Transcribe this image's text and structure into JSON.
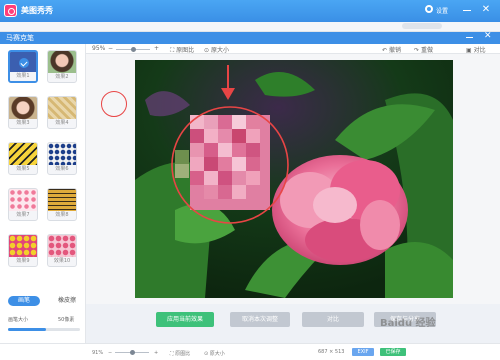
{
  "app": {
    "title": "美图秀秀",
    "settings_label": "设置"
  },
  "dialog": {
    "title": "马赛克笔"
  },
  "toolbar": {
    "zoom": "95%",
    "original_ratio": "原图比",
    "actual_size": "原大小",
    "undo": "撤销",
    "redo": "重做",
    "compare": "对比"
  },
  "effects": [
    {
      "label": "效果1",
      "selected": true
    },
    {
      "label": "效果2",
      "selected": false
    },
    {
      "label": "效果3",
      "selected": false
    },
    {
      "label": "效果4",
      "selected": false
    },
    {
      "label": "效果5",
      "selected": false
    },
    {
      "label": "效果6",
      "selected": false
    },
    {
      "label": "效果7",
      "selected": false
    },
    {
      "label": "效果8",
      "selected": false
    },
    {
      "label": "效果9",
      "selected": false
    },
    {
      "label": "效果10",
      "selected": false
    }
  ],
  "pen_tabs": {
    "brush": "画笔",
    "eraser": "橡皮擦"
  },
  "pen_size": {
    "label": "画笔大小",
    "value": "50像素",
    "level": 0.53
  },
  "actions": {
    "apply": "应用当前效果",
    "undo_step": "取消本次调整",
    "compare": "对比",
    "save": "保存与分享"
  },
  "watermark": "Baidu 经验",
  "status": {
    "zoom": "91%",
    "original_ratio": "原图比",
    "actual_size": "原大小",
    "dimensions": "687 × 513",
    "exif": "EXIF",
    "badge": "已保存"
  },
  "colors": {
    "accent": "#3d8fe6",
    "apply_green": "#3ec17a",
    "cursor_red": "#e84545"
  },
  "icons": [
    "gear-icon",
    "minimize-icon",
    "close-icon",
    "undo-icon",
    "redo-icon",
    "compare-icon",
    "check-icon",
    "arrow-down-icon"
  ]
}
